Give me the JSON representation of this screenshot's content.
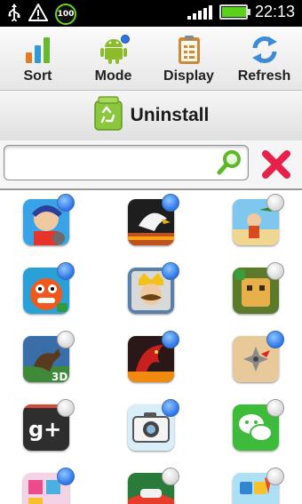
{
  "status_bar": {
    "battery_badge": "100",
    "battery_level": 1.0,
    "time": "22:13",
    "icons": [
      "usb-icon",
      "warning-icon",
      "battery-percent-badge",
      "signal-icon",
      "battery-icon"
    ]
  },
  "toolbar": {
    "sort_label": "Sort",
    "mode_label": "Mode",
    "display_label": "Display",
    "refresh_label": "Refresh"
  },
  "banner": {
    "uninstall_label": "Uninstall"
  },
  "search": {
    "value": "",
    "placeholder": ""
  },
  "apps": [
    {
      "icon": "jetpack-joyride-app-icon",
      "selected": true
    },
    {
      "icon": "eagle-game-app-icon",
      "selected": true
    },
    {
      "icon": "beach-adventure-app-icon",
      "selected": false
    },
    {
      "icon": "monster-app-icon",
      "selected": true
    },
    {
      "icon": "king-mustache-app-icon",
      "selected": true
    },
    {
      "icon": "cube-character-app-icon",
      "selected": false
    },
    {
      "icon": "horse-racing-3d-app-icon",
      "selected": false
    },
    {
      "icon": "dragon-app-icon",
      "selected": true
    },
    {
      "icon": "ninja-star-app-icon",
      "selected": true
    },
    {
      "icon": "google-plus-app-icon",
      "selected": false
    },
    {
      "icon": "camera-app-icon",
      "selected": true
    },
    {
      "icon": "wechat-app-icon",
      "selected": false
    },
    {
      "icon": "puzzle-app-icon",
      "selected": true
    },
    {
      "icon": "racing-app-icon",
      "selected": false
    },
    {
      "icon": "word-game-app-icon",
      "selected": false
    }
  ],
  "colors": {
    "selected_dot": "#2b74e6",
    "unselected_dot": "#d4d4d4",
    "clear_x": "#e8214a",
    "search_magnifier": "#5cb82a"
  }
}
